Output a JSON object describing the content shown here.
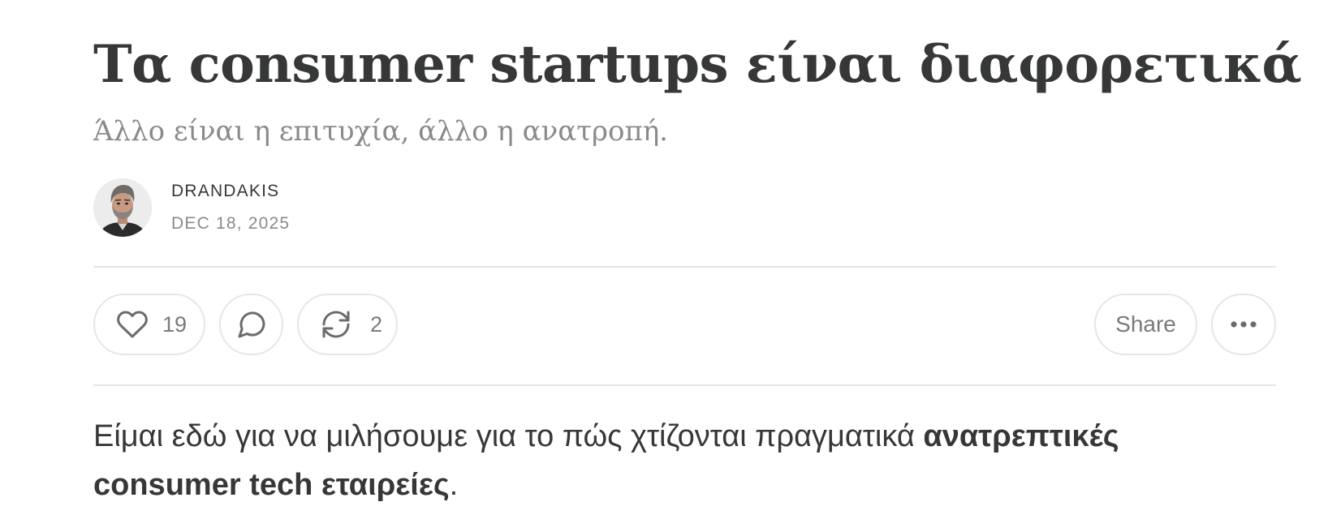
{
  "post": {
    "title": "Τα consumer startups είναι διαφορετικά",
    "subtitle": "Άλλο είναι η επιτυχία, άλλο η ανατροπή.",
    "author": "DRANDAKIS",
    "date": "DEC 18, 2025"
  },
  "actions": {
    "like_count": "19",
    "restack_count": "2",
    "share_label": "Share"
  },
  "body": {
    "text_before": "Είμαι εδώ για να μιλήσουμε για το πώς χτίζονται πραγματικά ",
    "bold_1": "ανατρεπτικές",
    "bold_2": "consumer tech εταιρείες",
    "text_after": "."
  },
  "icons": {
    "like": "heart-icon",
    "comment": "speech-bubble-icon",
    "restack": "restack-arrows-icon",
    "more": "ellipsis-icon"
  },
  "colors": {
    "text": "#363737",
    "muted": "#8a8a8a",
    "border": "#e6e6e6"
  }
}
